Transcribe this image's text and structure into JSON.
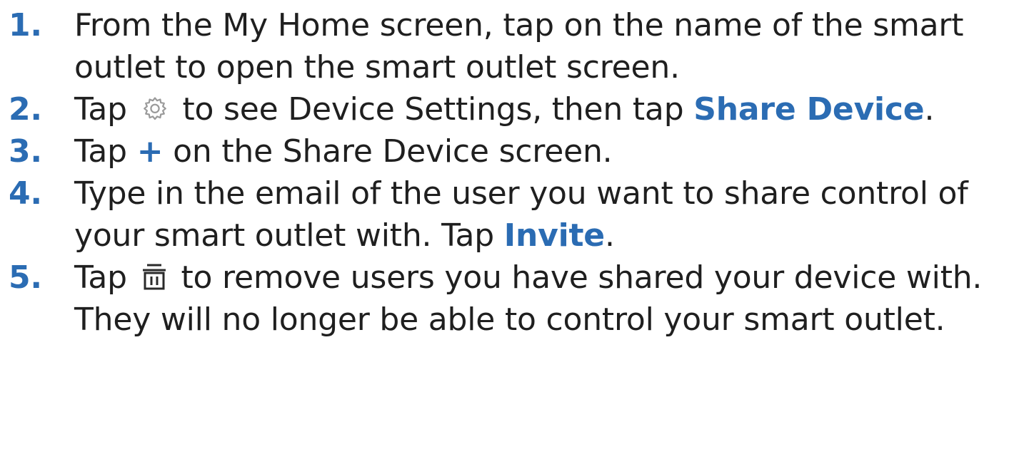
{
  "steps": [
    {
      "number": "1.",
      "text": "From the My Home screen, tap on the name of the smart outlet to open the smart outlet screen."
    },
    {
      "number": "2.",
      "pre": "Tap",
      "icon": "gear-icon",
      "post": "to see Device Settings, then tap",
      "emphasis": "Share Device",
      "end": "."
    },
    {
      "number": "3.",
      "pre": "Tap",
      "symbol": "+",
      "post": "on the Share Device screen."
    },
    {
      "number": "4.",
      "pre": "Type in the email of the user you want to share control of your smart outlet with. Tap",
      "emphasis": "Invite",
      "end": "."
    },
    {
      "number": "5.",
      "pre": "Tap",
      "icon": "trash-icon",
      "post": "to remove users you have shared your device with. They will no longer be able to control your smart outlet."
    }
  ],
  "colors": {
    "accent": "#2b6cb3",
    "text": "#1f1f1f",
    "icon_gray": "#9a9a9a",
    "icon_dark": "#2a2a2a"
  }
}
